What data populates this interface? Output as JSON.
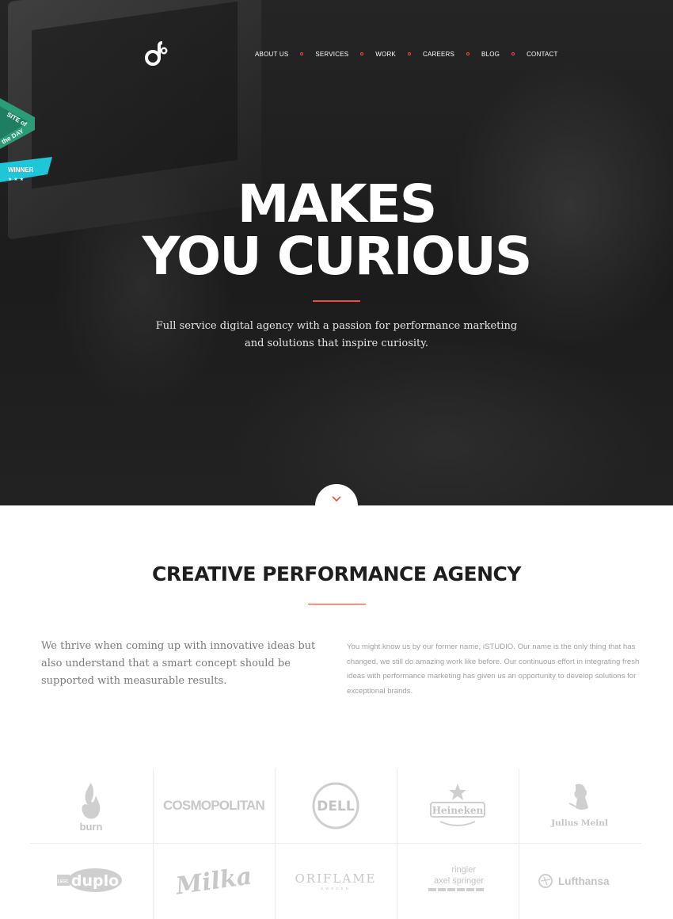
{
  "nav": {
    "items": [
      "ABOUT US",
      "SERVICES",
      "WORK",
      "CAREERS",
      "BLOG",
      "CONTACT"
    ]
  },
  "badge": {
    "site_of": "SITE of",
    "the_day": "the DAY",
    "winner": "WINNER"
  },
  "hero": {
    "title_line1": "MAKES",
    "title_line2": "YOU CURIOUS",
    "subtitle_line1": "Full service digital agency with a passion for performance marketing",
    "subtitle_line2": "and solutions that inspire curiosity."
  },
  "section": {
    "title": "CREATIVE PERFORMANCE AGENCY",
    "left_text": "We thrive when coming up with innovative ideas but also understand that a smart concept should be supported with measurable results.",
    "right_text": "You might know us by our former name, iSTUDIO. Our name is the only thing that has changed, we still do amazing work like before. Our continuous effort in integrating fresh ideas with performance marketing has given us an opportunity to develop solutions for exceptional brands."
  },
  "clients": {
    "burn": "burn",
    "cosmopolitan": "COSMOPOLITAN",
    "dell": "DELL",
    "heineken": "Heineken",
    "julius_meinl": "Julius Meinl",
    "lego_duplo": "duplo",
    "milka": "Milka",
    "oriflame": "ORIFLAME",
    "oriflame_sub": "SWEDEN",
    "ringier_1": "ringier",
    "ringier_2": "axel springer",
    "lufthansa": "Lufthansa"
  },
  "colors": {
    "accent": "#e8503a",
    "ribbon_green": "#2a9d78",
    "ribbon_cyan": "#1ec6d8"
  }
}
